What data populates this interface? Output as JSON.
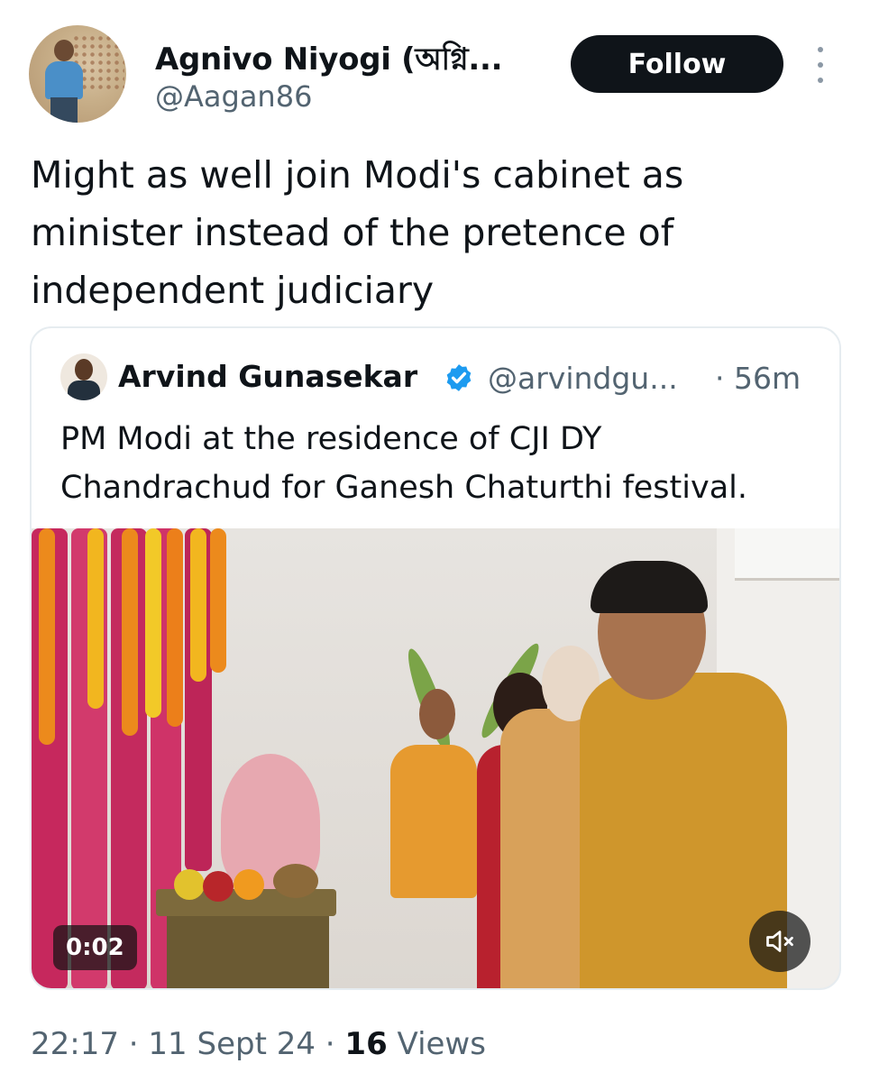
{
  "author": {
    "display_name": "Agnivo Niyogi (অগ্নি...",
    "handle": "@Aagan86"
  },
  "header": {
    "follow_label": "Follow",
    "more_icon": "more-vertical-icon"
  },
  "tweet": {
    "text": "Might as well join Modi's cabinet as minister instead of the pretence of independent judiciary"
  },
  "quoted_tweet": {
    "display_name": "Arvind Gunasekar",
    "verified": true,
    "verified_color": "#1d9bf0",
    "handle": "@arvindgu...",
    "time": "· 56m",
    "text": "PM Modi at the residence of CJI DY Chandrachud for Ganesh Chaturthi festival.",
    "video": {
      "duration": "0:02",
      "mute_icon": "volume-muted-icon"
    }
  },
  "meta": {
    "time": "22:17",
    "separator1": " · ",
    "date": "11 Sept 24",
    "separator2": " · ",
    "views_count": "16",
    "views_label": " Views"
  },
  "colors": {
    "text_primary": "#0f1419",
    "text_secondary": "#536471",
    "border": "#e6ecf0",
    "follow_bg": "#0f1419"
  }
}
